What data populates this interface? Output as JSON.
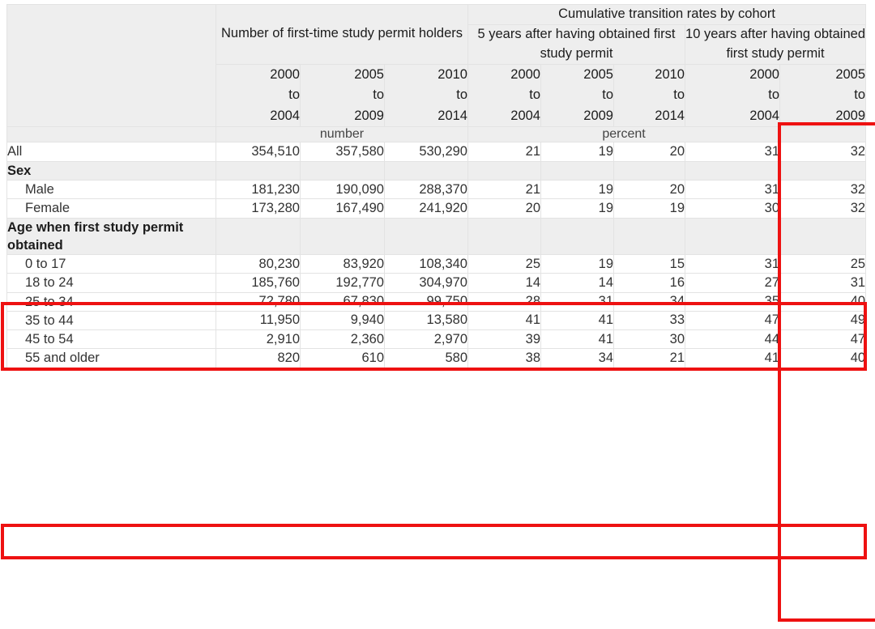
{
  "table": {
    "column_groups": [
      {
        "label": "",
        "span": 1
      },
      {
        "label": "Number of first-time study permit holders",
        "span": 3
      },
      {
        "label": "Cumulative transition rates by cohort",
        "span": 5
      }
    ],
    "subgroups": [
      {
        "label": "5 years after having obtained first study permit",
        "span": 3
      },
      {
        "label": "10 years after having obtained first study permit",
        "span": 2
      }
    ],
    "year_headers": [
      "2000 to 2004",
      "2005 to 2009",
      "2010 to 2014",
      "2000 to 2004",
      "2005 to 2009",
      "2010 to 2014",
      "2000 to 2004",
      "2005 to 2009"
    ],
    "year_header_lines": [
      [
        "2000",
        "to",
        "2004"
      ],
      [
        "2005",
        "to",
        "2009"
      ],
      [
        "2010",
        "to",
        "2014"
      ],
      [
        "2000",
        "to",
        "2004"
      ],
      [
        "2005",
        "to",
        "2009"
      ],
      [
        "2010",
        "to",
        "2014"
      ],
      [
        "2000",
        "to",
        "2004"
      ],
      [
        "2005",
        "to",
        "2009"
      ]
    ],
    "units": [
      {
        "label": "number",
        "span": 3
      },
      {
        "label": "percent",
        "span": 4
      },
      {
        "label": "",
        "span": 1
      }
    ],
    "rows": [
      {
        "type": "data",
        "indent": false,
        "label": "All",
        "values": [
          "354,510",
          "357,580",
          "530,290",
          "21",
          "19",
          "20",
          "31",
          "32"
        ]
      },
      {
        "type": "section",
        "indent": false,
        "label": "Sex",
        "values": [
          "",
          "",
          "",
          "",
          "",
          "",
          "",
          ""
        ]
      },
      {
        "type": "data",
        "indent": true,
        "label": "Male",
        "values": [
          "181,230",
          "190,090",
          "288,370",
          "21",
          "19",
          "20",
          "31",
          "32"
        ]
      },
      {
        "type": "data",
        "indent": true,
        "label": "Female",
        "values": [
          "173,280",
          "167,490",
          "241,920",
          "20",
          "19",
          "19",
          "30",
          "32"
        ]
      },
      {
        "type": "section",
        "indent": false,
        "label": "Age when first study permit obtained",
        "values": [
          "",
          "",
          "",
          "",
          "",
          "",
          "",
          ""
        ]
      },
      {
        "type": "data",
        "indent": true,
        "label": "0 to 17",
        "values": [
          "80,230",
          "83,920",
          "108,340",
          "25",
          "19",
          "15",
          "31",
          "25"
        ]
      },
      {
        "type": "data",
        "indent": true,
        "label": "18 to 24",
        "values": [
          "185,760",
          "192,770",
          "304,970",
          "14",
          "14",
          "16",
          "27",
          "31"
        ]
      },
      {
        "type": "data",
        "indent": true,
        "label": "25 to 34",
        "values": [
          "72,780",
          "67,830",
          "99,750",
          "28",
          "31",
          "34",
          "35",
          "40"
        ]
      },
      {
        "type": "data",
        "indent": true,
        "label": "35 to 44",
        "values": [
          "11,950",
          "9,940",
          "13,580",
          "41",
          "41",
          "33",
          "47",
          "49"
        ]
      },
      {
        "type": "data",
        "indent": true,
        "label": "45 to 54",
        "values": [
          "2,910",
          "2,360",
          "2,970",
          "39",
          "41",
          "30",
          "44",
          "47"
        ]
      },
      {
        "type": "data",
        "indent": true,
        "label": "55 and older",
        "values": [
          "820",
          "610",
          "580",
          "38",
          "34",
          "21",
          "41",
          "40"
        ]
      }
    ]
  },
  "annotations": {
    "highlight_color": "#ee1111",
    "items": [
      {
        "name": "highlight-column-10y-2005-2009",
        "kind": "column"
      },
      {
        "name": "highlight-rows-male-female",
        "kind": "rows"
      },
      {
        "name": "highlight-row-35-to-44",
        "kind": "row"
      }
    ]
  }
}
